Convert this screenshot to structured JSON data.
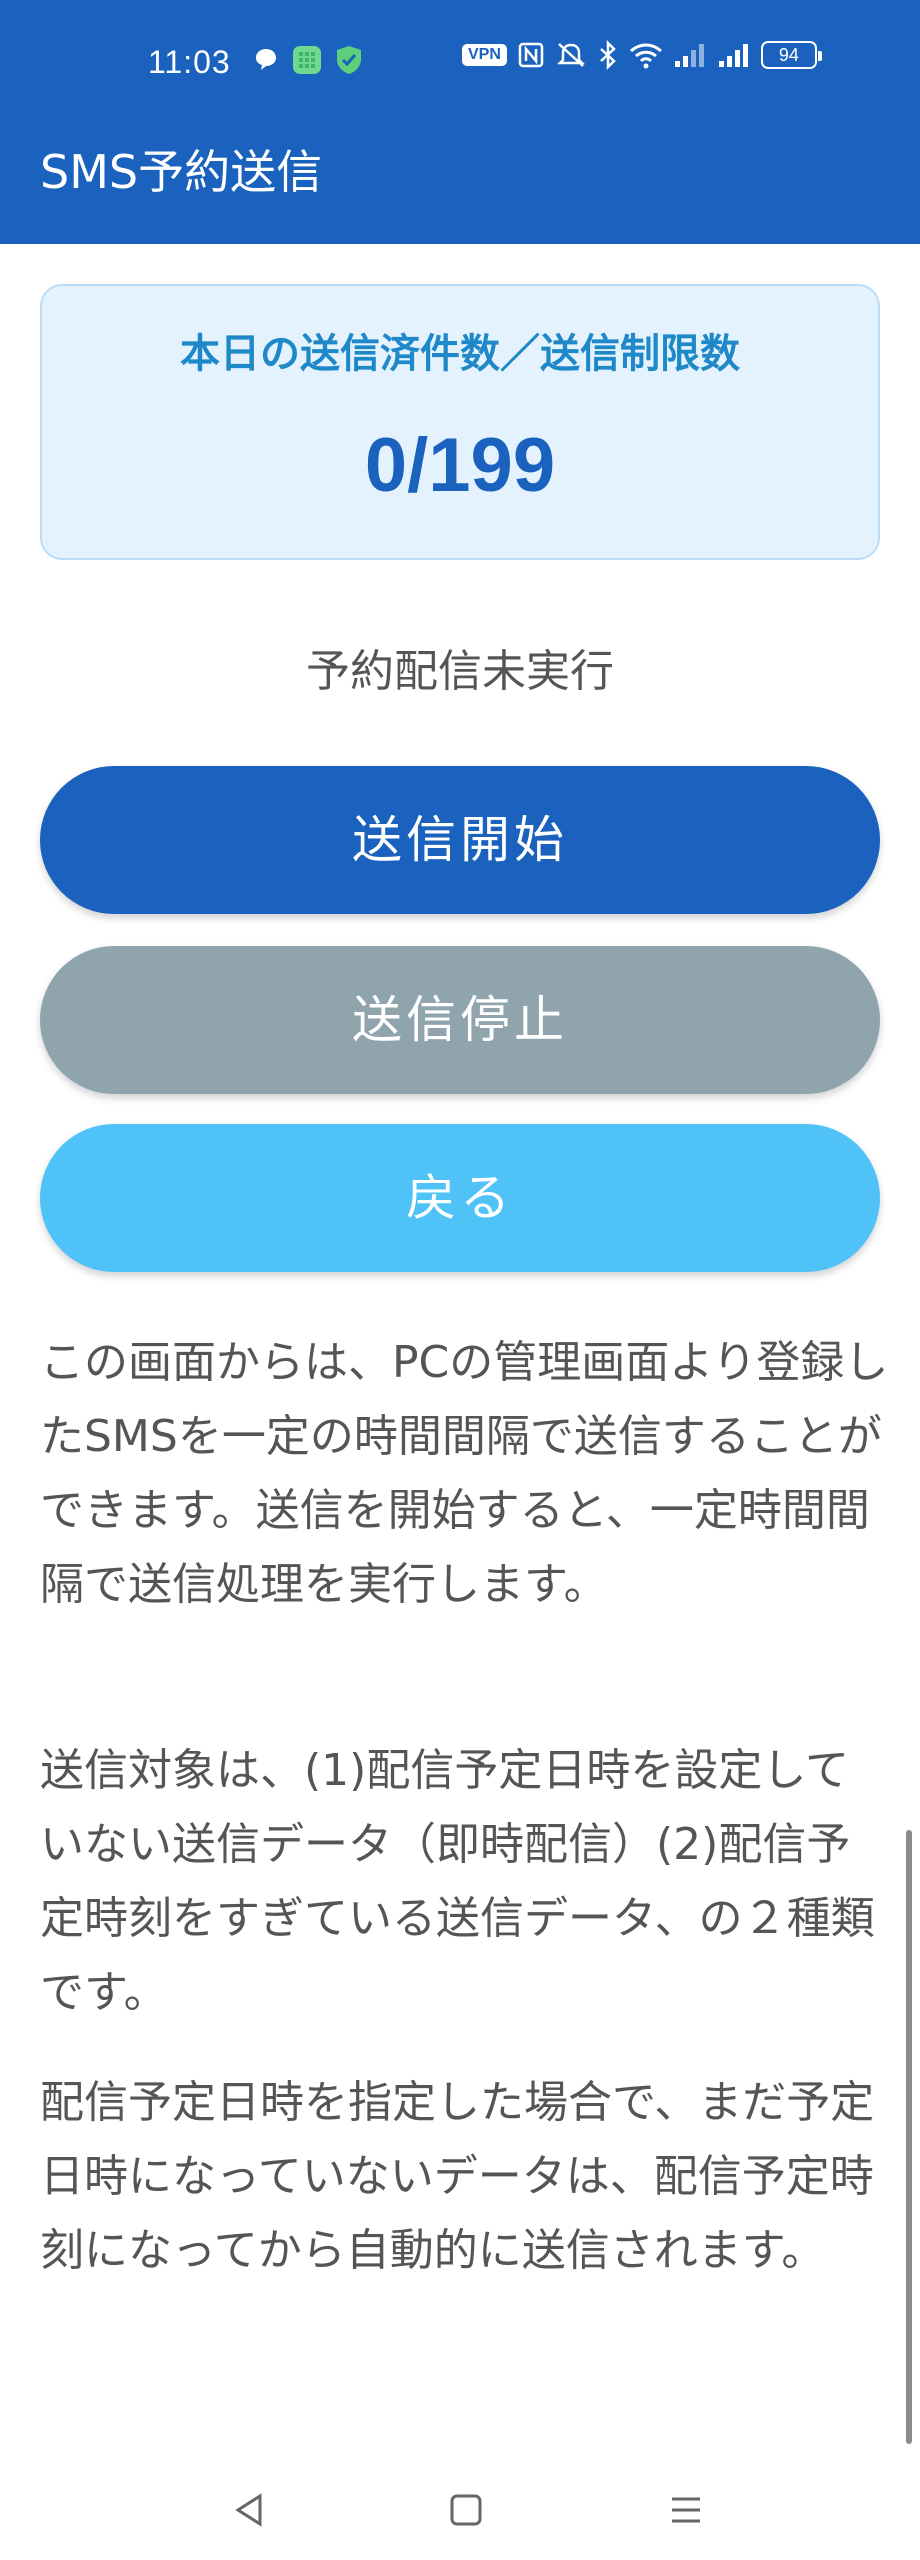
{
  "status_bar": {
    "time": "11:03",
    "vpn_label": "VPN",
    "battery_level": "94",
    "icons_left": [
      "chat-bubble-icon",
      "app-icon",
      "shield-check-icon"
    ],
    "icons_right": [
      "vpn-icon",
      "nfc-icon",
      "mute-icon",
      "bluetooth-icon",
      "wifi-icon",
      "signal-icon",
      "signal-icon",
      "battery-icon"
    ]
  },
  "header": {
    "title": "SMS予約送信",
    "color": "#1a62be"
  },
  "counter_card": {
    "label": "本日の送信済件数／送信制限数",
    "value": "0/199"
  },
  "status": {
    "text": "予約配信未実行"
  },
  "buttons": {
    "start": "送信開始",
    "stop": "送信停止",
    "back": "戻る"
  },
  "description": {
    "paragraph_1": "この画面からは、PCの管理画面より登録したSMSを一定の時間間隔で送信することができます。送信を開始すると、一定時間間隔で送信処理を実行します。",
    "paragraph_2": "送信対象は、(1)配信予定日時を設定していない送信データ（即時配信）(2)配信予定時刻をすぎている送信データ、の２種類です。",
    "paragraph_3": "配信予定日時を指定した場合で、まだ予定日時になっていないデータは、配信予定時刻になってから自動的に送信されます。"
  },
  "nav": {
    "icons": [
      "back-triangle-icon",
      "home-square-icon",
      "menu-lines-icon"
    ]
  }
}
